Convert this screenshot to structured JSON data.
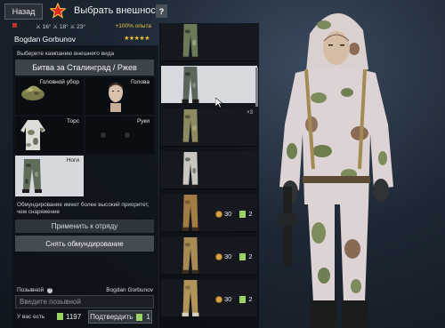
{
  "header": {
    "back_label": "Назад",
    "title": "Выбрать внешность",
    "help_label": "?"
  },
  "soldier": {
    "stats": "⚔ 16°  ⚔ 18°  ⚔ 23°",
    "xp_bonus": "+100% опыта",
    "name": "Bogdan Gorbunov",
    "stars": "★★★★★"
  },
  "campaign": {
    "label": "Выберите кампанию внешнего вида",
    "selected": "Битва за Сталинград / Ржев"
  },
  "slots": {
    "head_gear": "Головной убор",
    "head": "Голова",
    "torso": "Торс",
    "hands": "Руки",
    "legs": "Ноги"
  },
  "description": "Обмундирование имеет более высокий приоритет, чем снаряжение",
  "buttons": {
    "apply_to_squad": "Применить к отряду",
    "remove_uniform": "Снять обмундирование",
    "confirm": "Подтвердить",
    "confirm_cost": "1"
  },
  "callsign": {
    "label": "Позывной",
    "name": "Bogdan Gorbunov",
    "placeholder": "Введите позывной"
  },
  "wallet": {
    "label": "У вас есть",
    "coupons": "1197"
  },
  "items": [
    {
      "count": "",
      "price_silver": "",
      "price_coupon": ""
    },
    {
      "count": "",
      "price_silver": "",
      "price_coupon": ""
    },
    {
      "count": "×3",
      "price_silver": "",
      "price_coupon": ""
    },
    {
      "count": "",
      "price_silver": "",
      "price_coupon": ""
    },
    {
      "count": "",
      "price_silver": "30",
      "price_coupon": "2"
    },
    {
      "count": "",
      "price_silver": "30",
      "price_coupon": "2"
    },
    {
      "count": "",
      "price_silver": "30",
      "price_coupon": "2"
    }
  ],
  "colors": {
    "accent_star": "#e02a22",
    "coupon_green": "#9bd264",
    "rating_gold": "#f0c23a",
    "xp_gold": "#e8c240"
  },
  "icons": [
    "star-icon",
    "help-icon",
    "coin-icon",
    "coupon-icon",
    "cursor-icon",
    "info-icon"
  ]
}
